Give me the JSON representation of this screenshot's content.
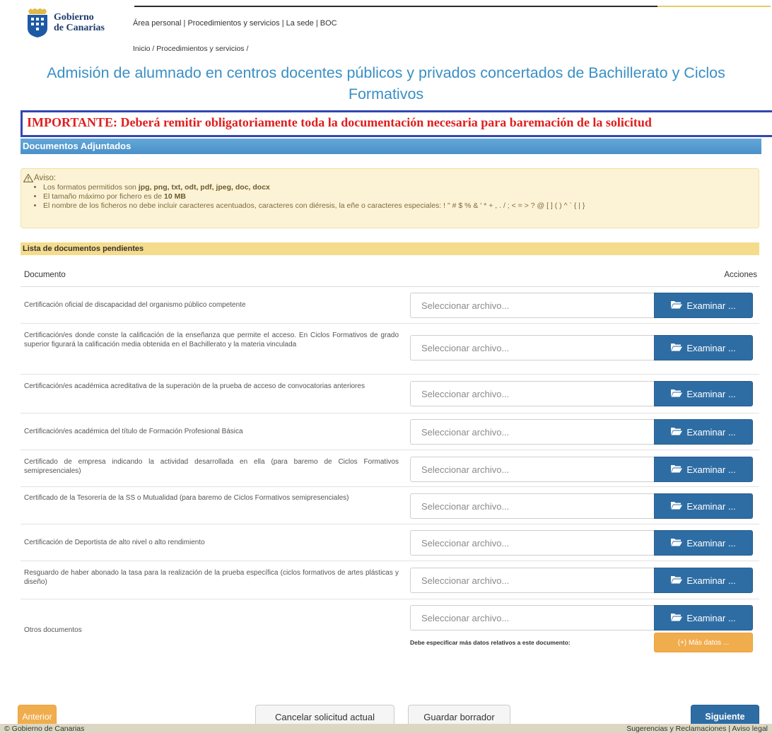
{
  "header": {
    "brand_line1": "Gobierno",
    "brand_line2": "de Canarias",
    "nav": "Área personal | Procedimientos y servicios | La sede | BOC",
    "breadcrumb": "Inicio / Procedimientos y servicios /"
  },
  "title": "Admisión de alumnado en centros docentes públicos y privados concertados de Bachillerato y Ciclos Formativos",
  "important": "IMPORTANTE: Deberá remitir obligatoriamente toda la documentación necesaria para baremación de la solicitud",
  "docs_section": {
    "title": "Documentos Adjuntados"
  },
  "alert": {
    "title": "Aviso:",
    "item1_prefix": "Los formatos permitidos son ",
    "item1_bold": "jpg, png, txt, odt, pdf, jpeg, doc, docx",
    "item2_prefix": "El tamaño máximo por fichero es de ",
    "item2_bold": "10 MB",
    "item3": "El nombre de los ficheros no debe incluir caracteres acentuados, caracteres con diéresis, la eñe o caracteres especiales: ! \" # $ % & ' * + , . / ; < = > ? @ [ ] ( ) ^ ` { | }"
  },
  "pending": {
    "title": "Lista de documentos pendientes",
    "col_document": "Documento",
    "col_actions": "Acciones",
    "file_placeholder": "Seleccionar archivo...",
    "browse_label": "Examinar ...",
    "rows": [
      {
        "desc": "Certificación oficial de discapacidad del organismo público competente"
      },
      {
        "desc": "Certificación/es donde conste la calificación de la enseñanza que permite el acceso. En Ciclos Formativos de grado superior figurará la calificación media obtenida en el Bachillerato y la materia vinculada"
      },
      {
        "desc": "Certificación/es académica acreditativa de la superación de la prueba de acceso de convocatorias anteriores"
      },
      {
        "desc": "Certificación/es académica del título de Formación Profesional Básica"
      },
      {
        "desc": "Certificado de empresa indicando la actividad desarrollada en ella (para baremo de Ciclos Formativos semipresenciales)"
      },
      {
        "desc": "Certificado de la Tesorería de la SS o Mutualidad (para baremo de Ciclos Formativos semipresenciales)"
      },
      {
        "desc": "Certificación de Deportista de alto nivel o alto rendimiento"
      },
      {
        "desc": "Resguardo de haber abonado la tasa para la realización de la prueba específica (ciclos formativos de artes plásticas y diseño)"
      },
      {
        "desc": "Otros documentos"
      }
    ],
    "more_label": "Debe especificar más datos relativos a este documento:",
    "more_button": "(+) Más datos ..."
  },
  "actions": {
    "prev": "Anterior",
    "cancel": "Cancelar solicitud actual",
    "draft": "Guardar borrador",
    "next": "Siguiente"
  },
  "footer": {
    "left": "© Gobierno de Canarias",
    "right": "Sugerencias y Reclamaciones | Aviso legal"
  },
  "colors": {
    "title_blue": "#3a8fc5",
    "important_red": "#e01e1e",
    "button_blue": "#2e6da4",
    "button_orange": "#f0ad4e"
  }
}
